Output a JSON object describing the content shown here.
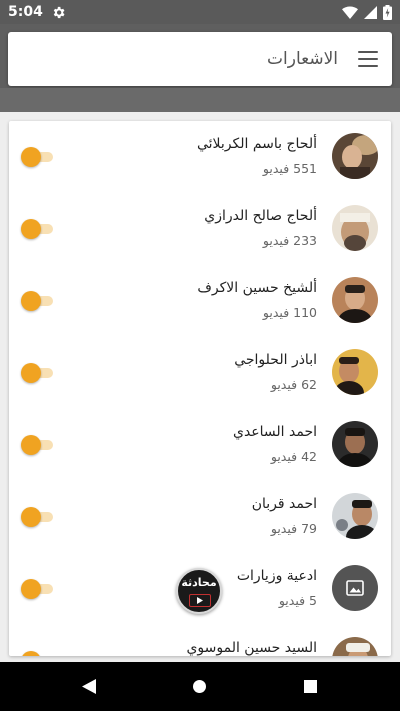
{
  "status_bar": {
    "time": "5:04",
    "icons": [
      "gear-icon",
      "wifi-icon",
      "cell-signal-icon",
      "battery-charging-icon"
    ]
  },
  "app_bar": {
    "title": "الاشعارات",
    "menu_icon": "hamburger-menu-icon"
  },
  "colors": {
    "toggle_thumb": "#f0a321",
    "toggle_track": "#f8e0b4",
    "status_bar": "#5a5a5a"
  },
  "list": [
    {
      "name": "ألحاج باسم الكربلائي",
      "count": "551 فيديو",
      "enabled": true
    },
    {
      "name": "ألحاج صالح الدرازي",
      "count": "233 فيديو",
      "enabled": true
    },
    {
      "name": "ألشيخ حسين الاكرف",
      "count": "110 فيديو",
      "enabled": true
    },
    {
      "name": "اباذر الحلواجي",
      "count": "62 فيديو",
      "enabled": true
    },
    {
      "name": "احمد الساعدي",
      "count": "42 فيديو",
      "enabled": true
    },
    {
      "name": "احمد قربان",
      "count": "79 فيديو",
      "enabled": true
    },
    {
      "name": "ادعية وزيارات",
      "count": "5 فيديو",
      "enabled": true,
      "avatar_icon": "image-placeholder-icon"
    },
    {
      "name": "السيد حسين الموسوي",
      "count": "",
      "enabled": true
    }
  ],
  "chat_head": {
    "label": "محادثة",
    "icon": "play-icon"
  },
  "nav_bar": {
    "icons": [
      "back-icon",
      "home-icon",
      "recents-icon"
    ]
  }
}
